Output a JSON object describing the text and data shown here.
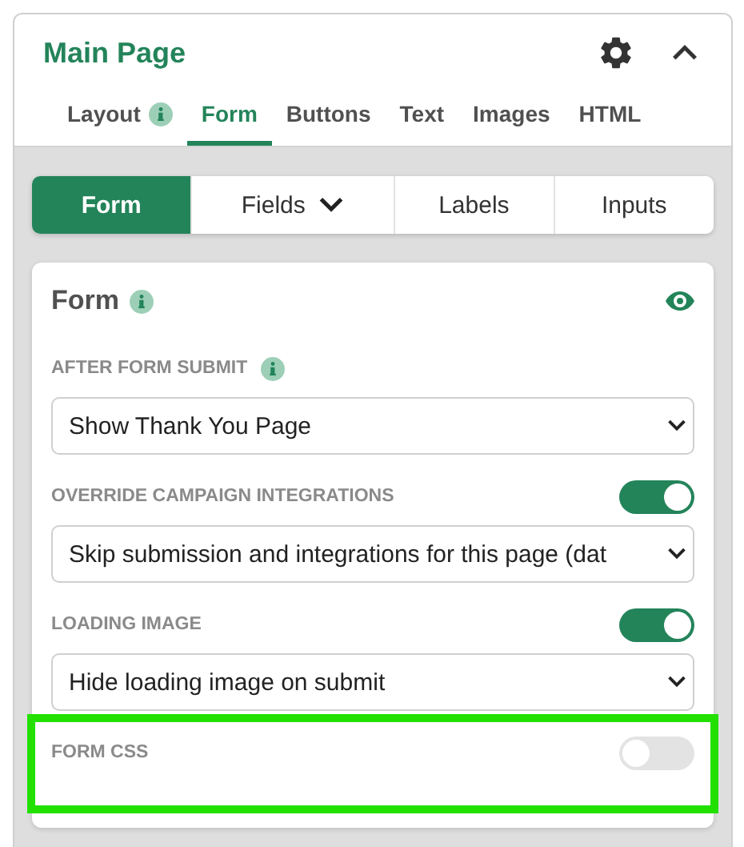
{
  "header": {
    "title": "Main Page"
  },
  "tabs": [
    {
      "label": "Layout",
      "info": true,
      "selected": false
    },
    {
      "label": "Form",
      "selected": true
    },
    {
      "label": "Buttons",
      "selected": false
    },
    {
      "label": "Text",
      "selected": false
    },
    {
      "label": "Images",
      "selected": false
    },
    {
      "label": "HTML",
      "selected": false
    }
  ],
  "segments": [
    {
      "label": "Form",
      "selected": true
    },
    {
      "label": "Fields",
      "dropdown": true,
      "selected": false
    },
    {
      "label": "Labels",
      "selected": false
    },
    {
      "label": "Inputs",
      "selected": false
    }
  ],
  "card": {
    "title": "Form",
    "info": true,
    "visible": true
  },
  "fields": [
    {
      "label": "AFTER FORM SUBMIT",
      "info": true,
      "value": "Show Thank You Page"
    },
    {
      "label": "OVERRIDE CAMPAIGN INTEGRATIONS",
      "toggle": true,
      "value": "Skip submission and integrations for this page (dat"
    },
    {
      "label": "LOADING IMAGE",
      "toggle": true,
      "value": "Hide loading image on submit"
    },
    {
      "label": "FORM CSS",
      "toggle": false,
      "highlighted": true
    }
  ]
}
